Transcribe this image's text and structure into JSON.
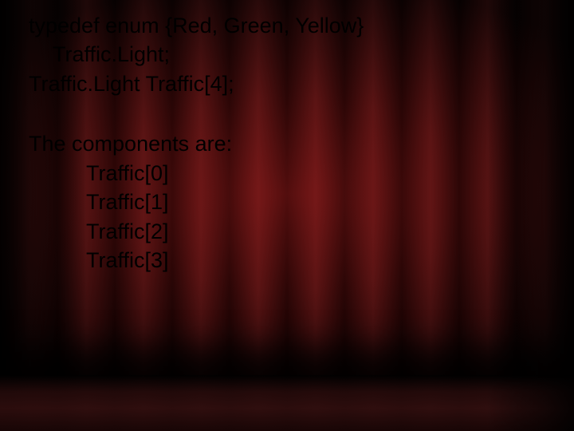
{
  "code": {
    "line1": "typedef enum {Red, Green, Yellow}",
    "line2": "Traffic.Light;",
    "line3": "Traffic.Light Traffic[4];"
  },
  "components": {
    "heading": "The components are:",
    "items": [
      "Traffic[0]",
      "Traffic[1]",
      "Traffic[2]",
      "Traffic[3]"
    ]
  }
}
